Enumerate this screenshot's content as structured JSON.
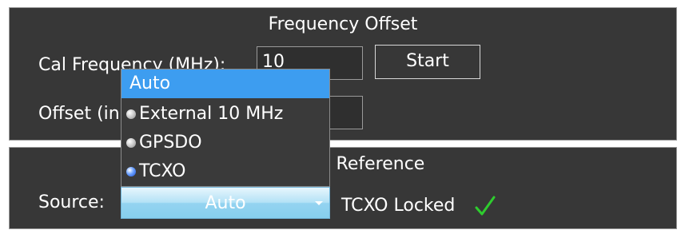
{
  "frequency_offset": {
    "title": "Frequency Offset",
    "cal_frequency_label": "Cal Frequency (MHz):",
    "cal_frequency_value": "10",
    "start_label": "Start",
    "offset_label": "Offset (in"
  },
  "reference": {
    "title": "z Reference",
    "source_label": "Source:",
    "source_value": "Auto",
    "status_text": "TCXO Locked",
    "status_icon": "check-icon",
    "status_color": "#2ecc2e"
  },
  "dropdown": {
    "options": [
      {
        "label": "Auto",
        "selected": true
      },
      {
        "label": "External 10 MHz",
        "selected": false
      },
      {
        "label": "GPSDO",
        "selected": false
      },
      {
        "label": "TCXO",
        "selected": false,
        "active": true
      }
    ]
  },
  "colors": {
    "panel_bg": "#373737",
    "highlight": "#3d9df0",
    "combo_accent": "#86cfee"
  }
}
